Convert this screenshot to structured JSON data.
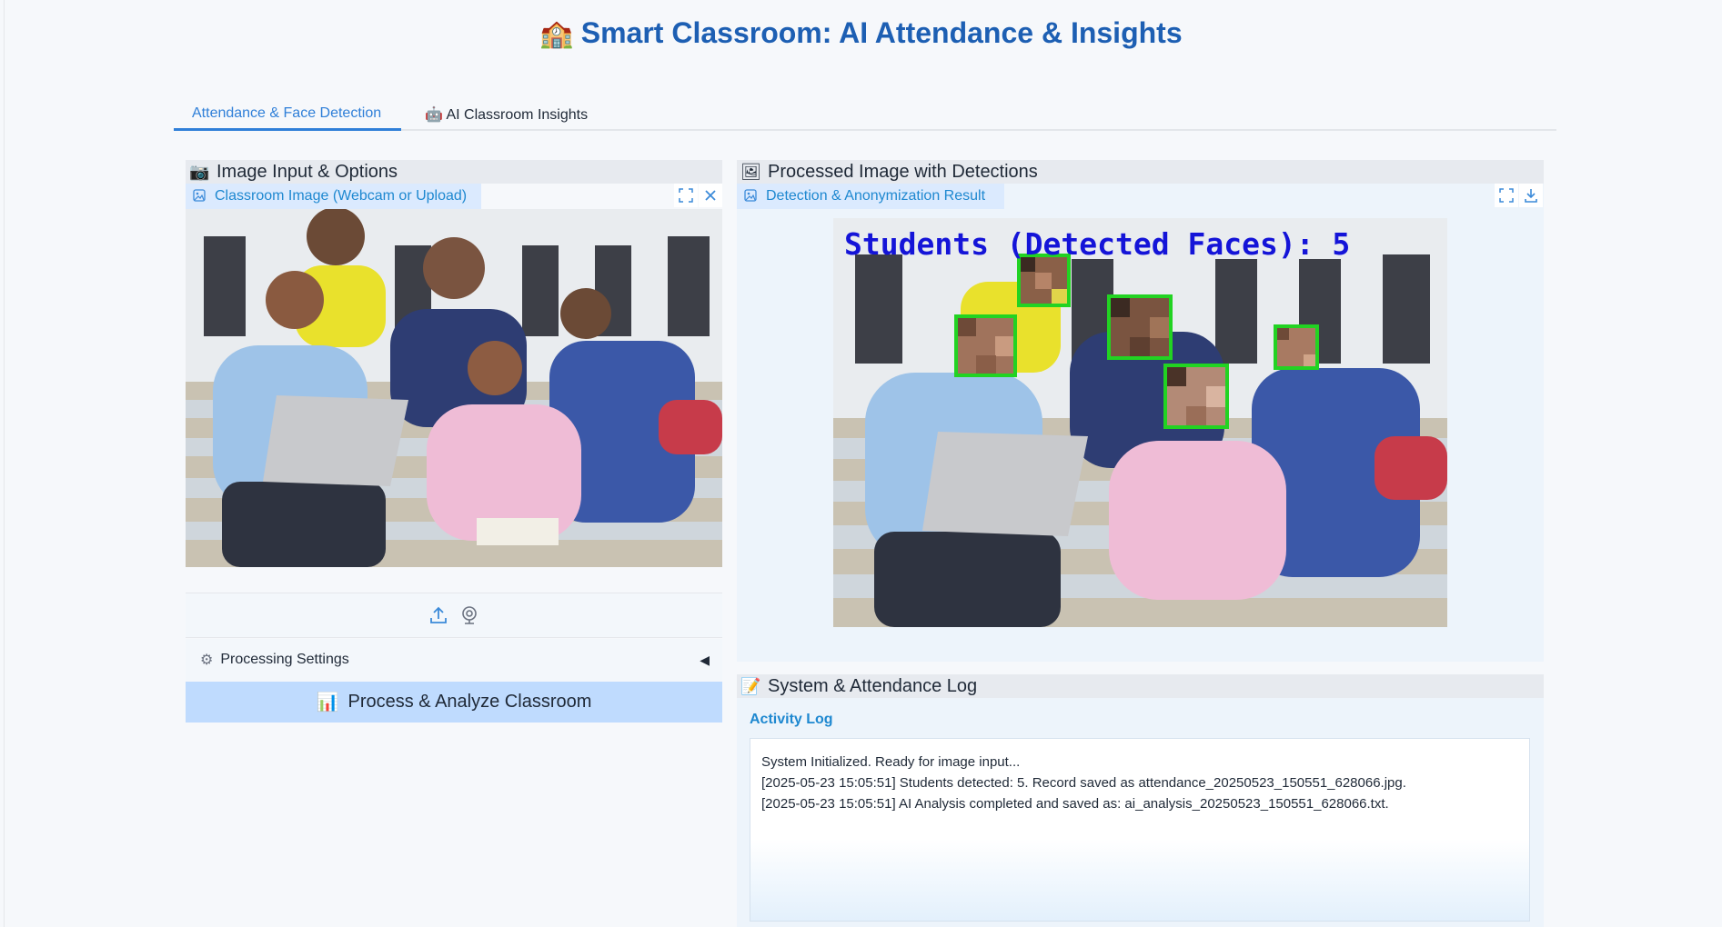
{
  "app": {
    "title_icon": "school-building-icon",
    "title": "Smart Classroom: AI Attendance & Insights"
  },
  "tabs": [
    {
      "label": "Attendance & Face Detection",
      "active": true
    },
    {
      "label": "AI Classroom Insights",
      "icon": "robot-icon",
      "active": false
    }
  ],
  "input_panel": {
    "icon": "camera-icon",
    "header": "Image Input & Options",
    "image_label": "Classroom Image (Webcam or Upload)",
    "settings_label": "Processing Settings",
    "settings_caret": "◀",
    "process_button": "Process & Analyze Classroom"
  },
  "output_panel": {
    "icon": "framed-picture-icon",
    "header": "Processed Image with Detections",
    "image_label": "Detection & Anonymization Result",
    "overlay_text": "Students (Detected Faces): 5",
    "box_color": "#22d322",
    "overlay_color": "#1414d8"
  },
  "log_panel": {
    "icon": "memo-icon",
    "header": "System & Attendance Log",
    "label": "Activity Log",
    "lines": [
      "System Initialized. Ready for image input...",
      "[2025-05-23 15:05:51] Students detected: 5. Record saved as attendance_20250523_150551_628066.jpg.",
      "[2025-05-23 15:05:51] AI Analysis completed and saved as: ai_analysis_20250523_150551_628066.txt."
    ]
  },
  "colors": {
    "accent": "#2f7fd8",
    "title": "#1d5fb3",
    "label_bg": "#dbeafe",
    "button_bg": "#bfdbfe"
  }
}
